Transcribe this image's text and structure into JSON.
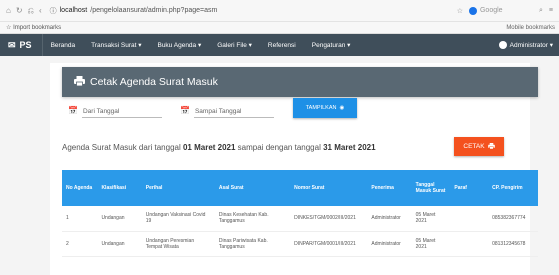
{
  "browser": {
    "url_host": "localhost",
    "url_path": "/pengelolaansurat/admin.php?page=asm",
    "search_placeholder": "Google",
    "bookmark_import": "Import bookmarks",
    "bookmark_mobile": "Mobile bookmarks"
  },
  "navbar": {
    "brand": "PS",
    "items": [
      {
        "label": "Beranda"
      },
      {
        "label": "Transaksi Surat ▾"
      },
      {
        "label": "Buku Agenda ▾"
      },
      {
        "label": "Galeri File ▾"
      },
      {
        "label": "Referensi"
      },
      {
        "label": "Pengaturan ▾"
      }
    ],
    "user": "Administrator ▾"
  },
  "card": {
    "title": "Cetak Agenda Surat Masuk",
    "from_placeholder": "Dari Tanggal",
    "to_placeholder": "Sampai Tanggal",
    "show_button": "TAMPILKAN",
    "summary_prefix": "Agenda Surat Masuk dari tanggal ",
    "summary_from": "01 Maret 2021",
    "summary_mid": " sampai dengan tanggal ",
    "summary_to": "31 Maret 2021",
    "print_button": "CETAK"
  },
  "table": {
    "headers": [
      "No Agenda",
      "Klasifikasi",
      "Perihal",
      "Asal Surat",
      "Nomor Surat",
      "Penerima",
      "Tanggal Masuk Surat",
      "Paraf",
      "CP. Pengirim"
    ],
    "rows": [
      [
        "1",
        "Undangan",
        "Undangan Vaksinasi Covid 19",
        "Dinas Kesehatan Kab. Tanggamus",
        "DINKES/TGM/0002/III/2021",
        "Administrator",
        "05 Maret 2021",
        "",
        "085382367774"
      ],
      [
        "2",
        "Undangan",
        "Undangan Peresmian Tempat Wisata",
        "Dinas Pariwisata Kab. Tanggamus",
        "DINPAR/TGM/0001/III/2021",
        "Administrator",
        "05 Maret 2021",
        "",
        "081312345678"
      ]
    ]
  },
  "colors": {
    "navbar": "#3f4e5a",
    "card_header": "#596873",
    "table_header": "#2b9ae9",
    "show_button": "#1e90e6",
    "print_button": "#f4511e"
  }
}
